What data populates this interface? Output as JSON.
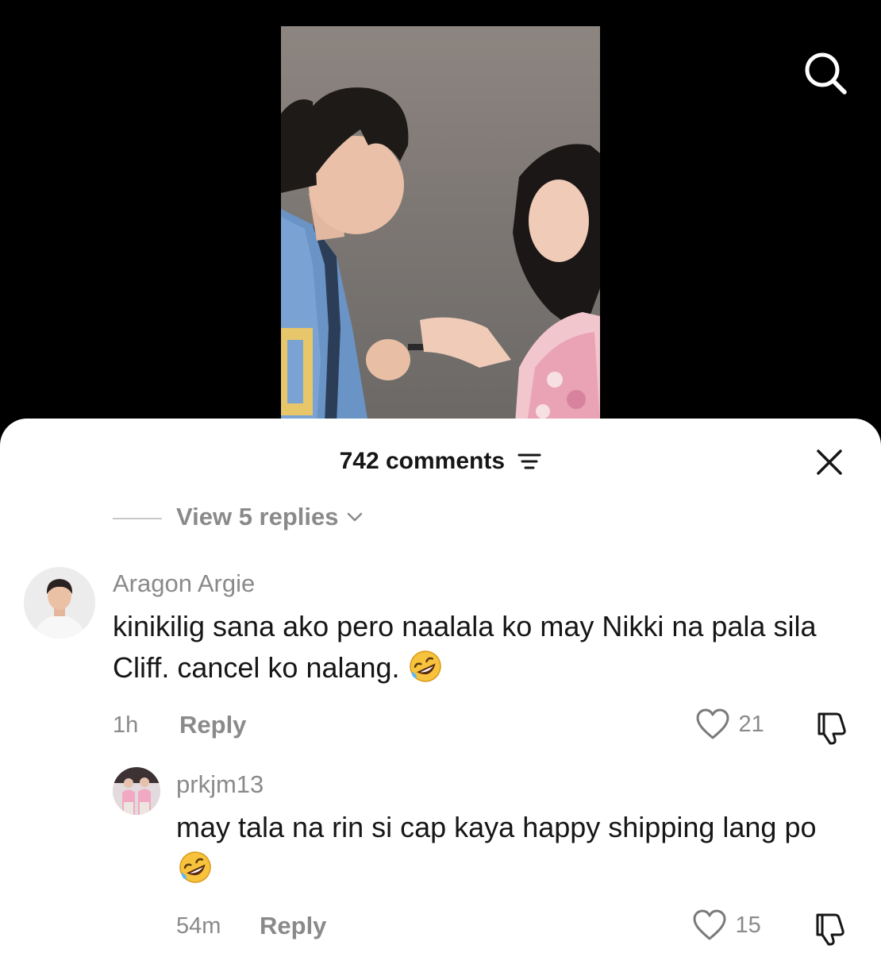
{
  "header": {
    "comments_count": "742 comments",
    "icons": {
      "search": "search-icon",
      "sort": "sort-lines-icon",
      "close": "close-icon"
    }
  },
  "thread": {
    "view_replies_label": "View 5 replies"
  },
  "comments": [
    {
      "username": "Aragon Argie",
      "text": "kinikilig sana ako pero naalala ko may Nikki na pala sila Cliff. cancel ko nalang.",
      "emoji": "rolling-on-floor-laughing-emoji",
      "time": "1h",
      "reply_label": "Reply",
      "likes": "21"
    },
    {
      "username": "prkjm13",
      "text": "may tala na rin si cap kaya happy shipping lang po",
      "emoji": "rolling-on-floor-laughing-emoji",
      "time": "54m",
      "reply_label": "Reply",
      "likes": "15"
    }
  ],
  "colors": {
    "sheet_bg": "#ffffff",
    "text": "#161616",
    "muted": "#8a8a8a",
    "video_bg": "#000000"
  }
}
